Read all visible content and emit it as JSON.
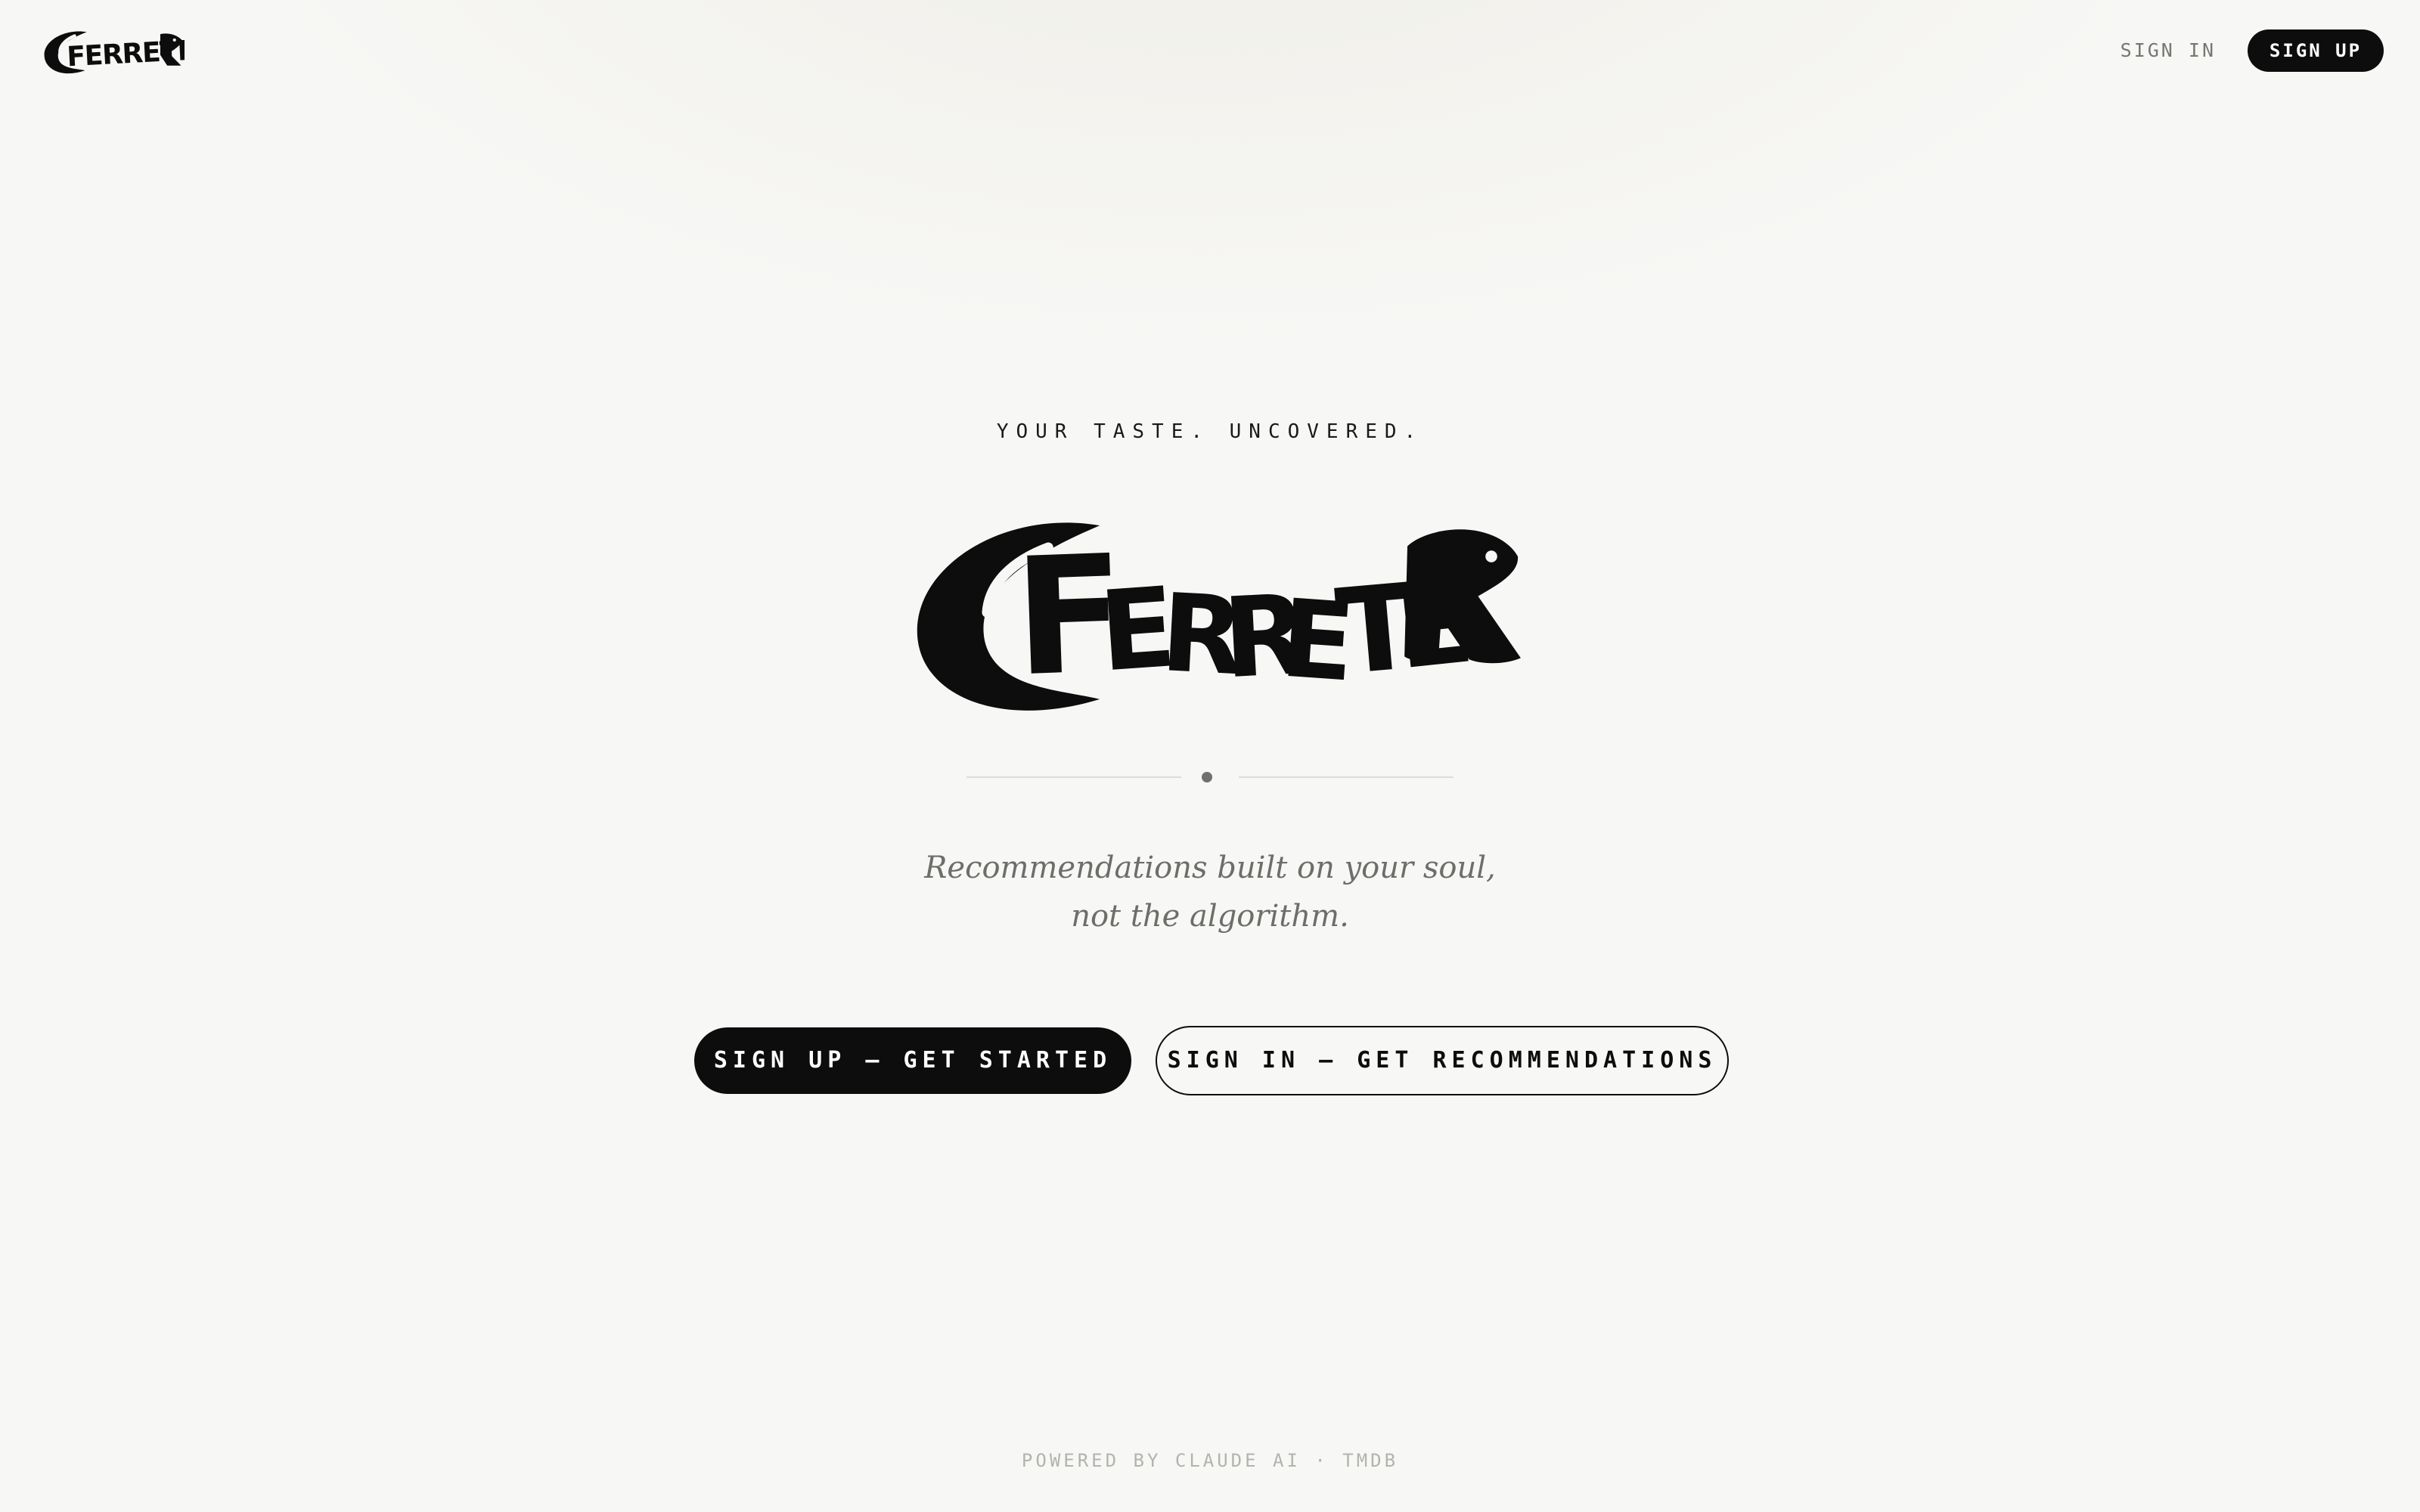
{
  "header": {
    "brand": "FERRETER",
    "nav": {
      "sign_in": "SIGN IN",
      "sign_up": "SIGN UP"
    }
  },
  "hero": {
    "tagline": "YOUR TASTE. UNCOVERED.",
    "logo_text": "FERRETER",
    "subtitle_line1": "Recommendations built on your soul,",
    "subtitle_line2": "not the algorithm.",
    "primary_cta": "SIGN UP — GET STARTED",
    "secondary_cta": "SIGN IN — GET RECOMMENDATIONS"
  },
  "footer": {
    "text": "POWERED BY CLAUDE AI · TMDB"
  },
  "colors": {
    "background": "#f7f7f5",
    "ink": "#0d0d0d",
    "muted": "#6d6d6a",
    "footer": "#b3b3ae"
  },
  "icons": {
    "logo": "ferret-wordmark-logo",
    "divider": "divider-dot"
  }
}
